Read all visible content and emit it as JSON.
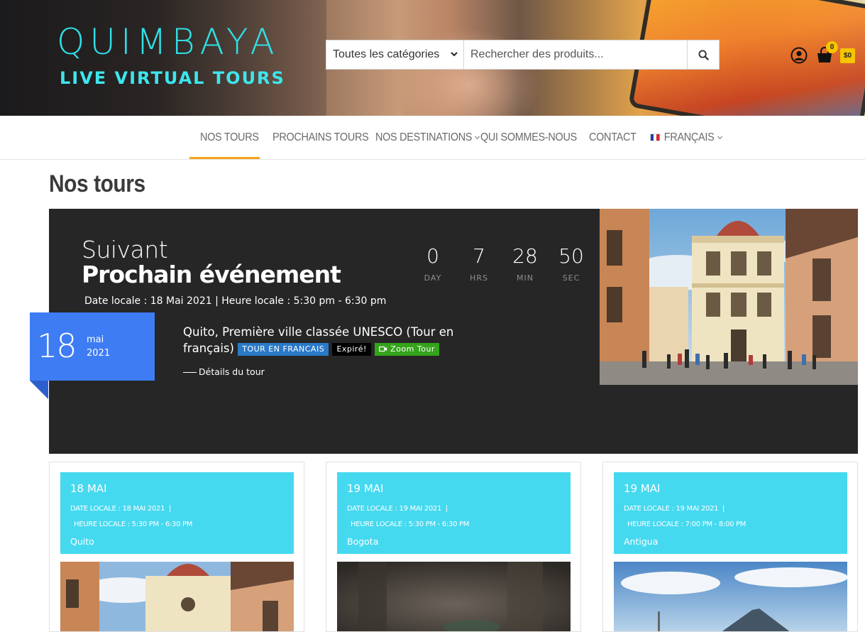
{
  "header": {
    "logo_main": "QUIMBAYA",
    "logo_sub": "LIVE VIRTUAL TOURS",
    "search": {
      "category": "Toutes les catégories",
      "placeholder": "Rechercher des produits..."
    },
    "cart_count": "0",
    "cart_total": "$0"
  },
  "nav": {
    "items": [
      "NOS TOURS",
      "PROCHAINS TOURS",
      "NOS DESTINATIONS",
      "QUI SOMMES-NOUS",
      "CONTACT",
      "FRANÇAIS"
    ],
    "active": "NOS TOURS",
    "accent_color": "#f2a51b"
  },
  "page": {
    "title": "Nos tours"
  },
  "featured": {
    "label": "Suivant",
    "title": "Prochain événement",
    "meta": "Date locale : 18 Mai 2021  |  Heure locale : 5:30 pm - 6:30 pm",
    "countdown": [
      {
        "value": "0",
        "label": "DAY"
      },
      {
        "value": "7",
        "label": "HRS"
      },
      {
        "value": "28",
        "label": "MIN"
      },
      {
        "value": "50",
        "label": "SEC"
      }
    ],
    "date_day": "18",
    "date_month": "mai",
    "date_year": "2021",
    "event_title": "Quito, Première ville classée UNESCO (Tour en français)",
    "tags": {
      "language": "TOUR EN FRANCAIS",
      "status": "Expiré!",
      "zoom": "Zoom Tour"
    },
    "details_link": "Détails du tour",
    "badge_color": "#3e7cf4"
  },
  "cards": [
    {
      "date": "18 MAI",
      "local_date": "DATE LOCALE : 18 MAI 2021",
      "local_time": "HEURE LOCALE : 5:30 PM - 6:30 PM",
      "city": "Quito"
    },
    {
      "date": "19 MAI",
      "local_date": "DATE LOCALE : 19 MAI 2021",
      "local_time": "HEURE LOCALE : 5:30 PM - 6:30 PM",
      "city": "Bogota"
    },
    {
      "date": "19 MAI",
      "local_date": "DATE LOCALE : 19 MAI 2021",
      "local_time": "HEURE LOCALE : 7:00 PM - 8:00 PM",
      "city": "Antigua"
    }
  ],
  "icons": [
    "search-icon",
    "account-icon",
    "cart-icon",
    "chevron-down-icon",
    "video-icon",
    "flag-fr-icon"
  ]
}
